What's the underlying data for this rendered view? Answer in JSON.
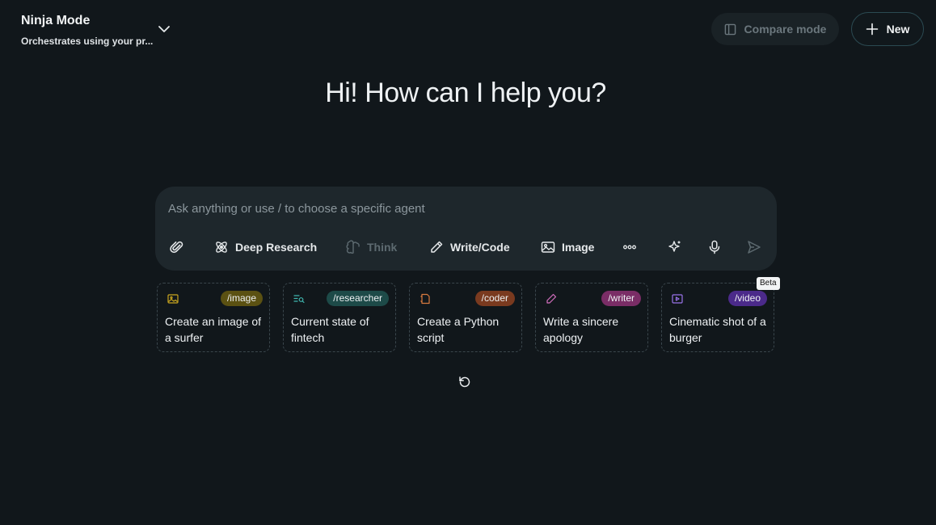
{
  "header": {
    "mode_title": "Ninja Mode",
    "mode_subtitle": "Orchestrates using your pr...",
    "mode_chevron_icon": "chevron-down-icon",
    "compare_label": "Compare mode",
    "compare_icon": "split-panel-icon",
    "new_label": "New",
    "new_icon": "plus-icon"
  },
  "greeting": "Hi! How can I help you?",
  "composer": {
    "placeholder": "Ask anything or use / to choose a specific agent",
    "value": "",
    "tools": [
      {
        "icon": "paperclip-icon",
        "label": ""
      },
      {
        "icon": "atom-icon",
        "label": "Deep Research"
      },
      {
        "icon": "brain-icon",
        "label": "Think",
        "state": "disabled"
      },
      {
        "icon": "pencil-icon",
        "label": "Write/Code"
      },
      {
        "icon": "image-icon",
        "label": "Image"
      },
      {
        "icon": "more-dots-icon",
        "label": ""
      },
      {
        "icon": "sparkle-icon",
        "label": ""
      },
      {
        "icon": "microphone-icon",
        "label": ""
      },
      {
        "icon": "send-icon",
        "label": "",
        "state": "disabled"
      }
    ]
  },
  "suggestions": [
    {
      "tag": "/image",
      "tag_color": "#5b5112",
      "icon": "image-icon",
      "icon_color": "#c9a51f",
      "text": "Create an image of a surfer"
    },
    {
      "tag": "/researcher",
      "tag_color": "#1d4a48",
      "icon": "search-list-icon",
      "icon_color": "#3fb6ae",
      "text": "Current state of fintech"
    },
    {
      "tag": "/coder",
      "tag_color": "#7a3a1f",
      "icon": "code-icon",
      "icon_color": "#d77a3f",
      "text": "Create a Python script"
    },
    {
      "tag": "/writer",
      "tag_color": "#7a2d66",
      "icon": "pencil-icon",
      "icon_color": "#d56fc0",
      "text": "Write a sincere apology"
    },
    {
      "tag": "/video",
      "tag_color": "#4b2a8a",
      "icon": "video-icon",
      "icon_color": "#9a73ea",
      "text": "Cinematic shot of a burger",
      "badge": "Beta"
    }
  ],
  "refresh_icon": "refresh-icon"
}
